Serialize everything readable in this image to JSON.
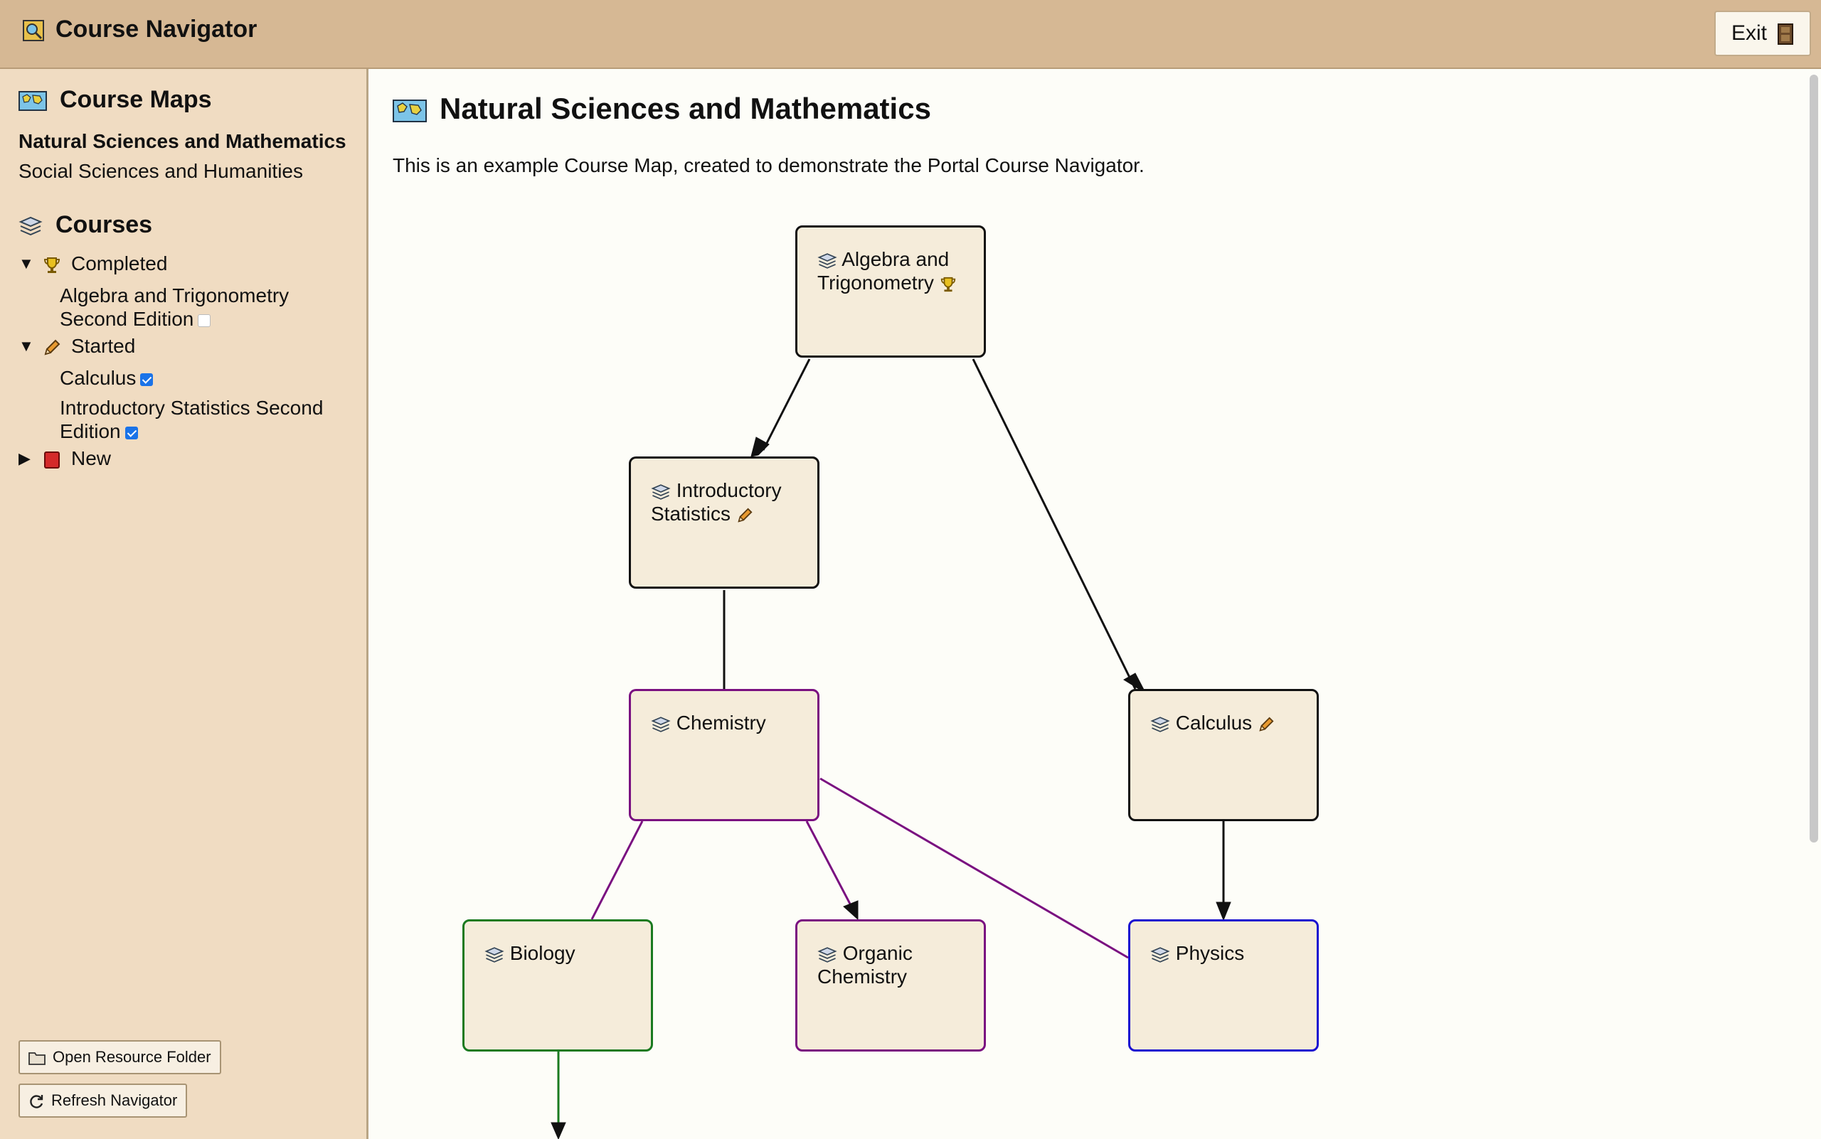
{
  "app": {
    "title": "Course Navigator",
    "exit_label": "Exit"
  },
  "sidebar": {
    "maps_heading": "Course Maps",
    "maps": [
      {
        "label": "Natural Sciences and Mathematics",
        "active": true
      },
      {
        "label": "Social Sciences and Humanities",
        "active": false
      }
    ],
    "courses_heading": "Courses",
    "groups": [
      {
        "label": "Completed",
        "expanded": true,
        "items": [
          {
            "line1": "Algebra and Trigonometry",
            "line2": "Second Edition",
            "checked": false
          }
        ]
      },
      {
        "label": "Started",
        "expanded": true,
        "items": [
          {
            "line1": "Calculus",
            "checked": true
          },
          {
            "line1": "Introductory Statistics Second",
            "line2": "Edition",
            "checked": true
          }
        ]
      },
      {
        "label": "New",
        "expanded": false,
        "items": []
      }
    ],
    "buttons": {
      "open_resource": "Open Resource Folder",
      "refresh": "Refresh Navigator"
    }
  },
  "main": {
    "title": "Natural Sciences and Mathematics",
    "description": "This is an example Course Map, created to demonstrate the Portal Course Navigator.",
    "nodes": [
      {
        "id": "algebra",
        "line1": "Algebra and",
        "line2": "Trigonometry",
        "status": "completed"
      },
      {
        "id": "stats",
        "line1": "Introductory",
        "line2": "Statistics",
        "status": "started"
      },
      {
        "id": "chemistry",
        "line1": "Chemistry",
        "status": ""
      },
      {
        "id": "calculus",
        "line1": "Calculus",
        "status": "started"
      },
      {
        "id": "biology",
        "line1": "Biology",
        "status": ""
      },
      {
        "id": "organic",
        "line1": "Organic",
        "line2": "Chemistry",
        "status": ""
      },
      {
        "id": "physics",
        "line1": "Physics",
        "status": ""
      }
    ]
  },
  "colors": {
    "header": "#d6b894",
    "sidebar": "#f0dcc2",
    "node_fill": "#f5ecda",
    "purple": "#7a1080",
    "green": "#1a7a20",
    "blue": "#1a10d0"
  }
}
